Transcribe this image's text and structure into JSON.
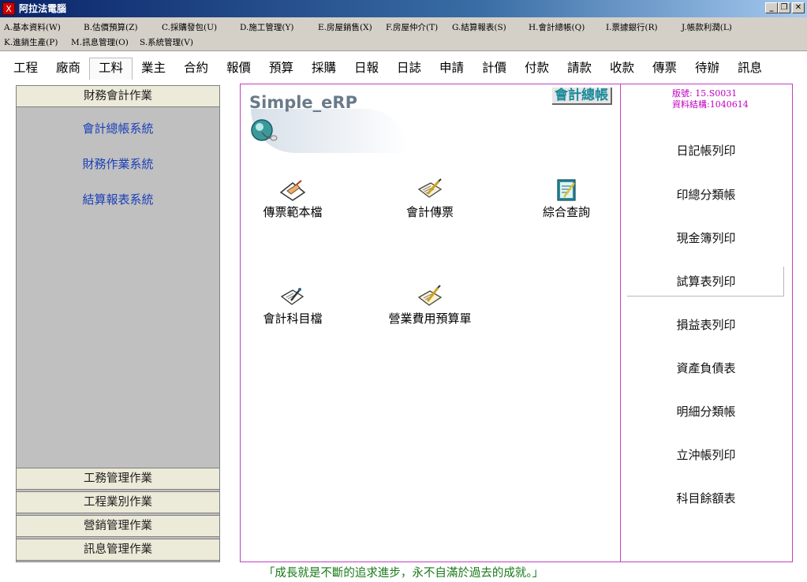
{
  "window": {
    "title": "阿拉法電腦"
  },
  "menu": [
    "A.基本資料(W)",
    "B.估價預算(Z)",
    "C.採購發包(U)",
    "D.施工管理(Y)",
    "E.房屋銷售(X)",
    "F.房屋仲介(T)",
    "G.結算報表(S)",
    "H.會計總帳(Q)",
    "I.票據銀行(R)",
    "J.帳款利潤(L)",
    "K.進銷生產(P)",
    "M.訊息管理(O)",
    "S.系統管理(V)"
  ],
  "modules": [
    "工程",
    "廠商",
    "工料",
    "業主",
    "合約",
    "報價",
    "預算",
    "採購",
    "日報",
    "日誌",
    "申請",
    "計價",
    "付款",
    "請款",
    "收款",
    "傳票",
    "待辦",
    "訊息"
  ],
  "left_nav": {
    "header": "財務會計作業",
    "links": [
      "會計總帳系統",
      "財務作業系統",
      "結算報表系統"
    ],
    "sections": [
      "工務管理作業",
      "工程業別作業",
      "營銷管理作業",
      "訊息管理作業"
    ]
  },
  "main": {
    "logo": "Simple_eRP",
    "module_title": "會計總帳",
    "tools": [
      "傳票範本檔",
      "會計傳票",
      "綜合查詢",
      "會計科目檔",
      "營業費用預算單"
    ]
  },
  "right": {
    "version": "版號:  15.S0031",
    "data_structure": "資料結構:1040614",
    "reports": [
      "日記帳列印",
      "印總分類帳",
      "現金簿列印",
      "試算表列印",
      "損益表列印",
      "資產負債表",
      "明細分類帳",
      "立沖帳列印",
      "科目餘額表"
    ],
    "selected_report": "試算表列印"
  },
  "motto": "「成長就是不斷的追求進步，永不自滿於過去的成就。」"
}
